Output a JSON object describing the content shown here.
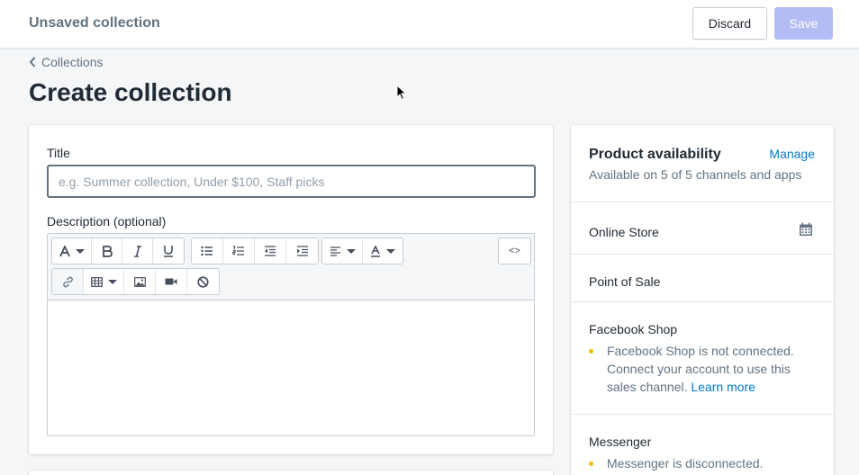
{
  "topbar": {
    "title": "Unsaved collection",
    "discard_label": "Discard",
    "save_label": "Save"
  },
  "breadcrumb": {
    "label": "Collections"
  },
  "page": {
    "title": "Create collection"
  },
  "form": {
    "title_label": "Title",
    "title_placeholder": "e.g. Summer collection, Under $100, Staff picks",
    "title_value": "",
    "description_label": "Description (optional)",
    "toolbar": {
      "row1": [
        "font-icon",
        "bold-icon",
        "italic-icon",
        "underline-icon",
        "bulleted-list-icon",
        "numbered-list-icon",
        "outdent-icon",
        "indent-icon",
        "align-icon",
        "text-color-icon",
        "html-code-icon"
      ],
      "row2": [
        "link-icon",
        "table-icon",
        "image-icon",
        "video-icon",
        "clear-formatting-icon"
      ],
      "code_label": "<>"
    }
  },
  "availability": {
    "heading": "Product availability",
    "manage_label": "Manage",
    "summary": "Available on 5 of 5 channels and apps",
    "channels": [
      {
        "name": "Online Store"
      },
      {
        "name": "Point of Sale"
      },
      {
        "name": "Facebook Shop",
        "note_lines": [
          "Facebook Shop is not connected.",
          "Connect your account to use this",
          "sales channel."
        ],
        "link": "Learn more"
      },
      {
        "name": "Messenger",
        "note_lines": [
          "Messenger is disconnected."
        ]
      }
    ]
  },
  "colors": {
    "accent": "#5c6ac4",
    "link": "#007ace",
    "warning_dot": "#eec200",
    "save_disabled": "#b3bcf5"
  }
}
